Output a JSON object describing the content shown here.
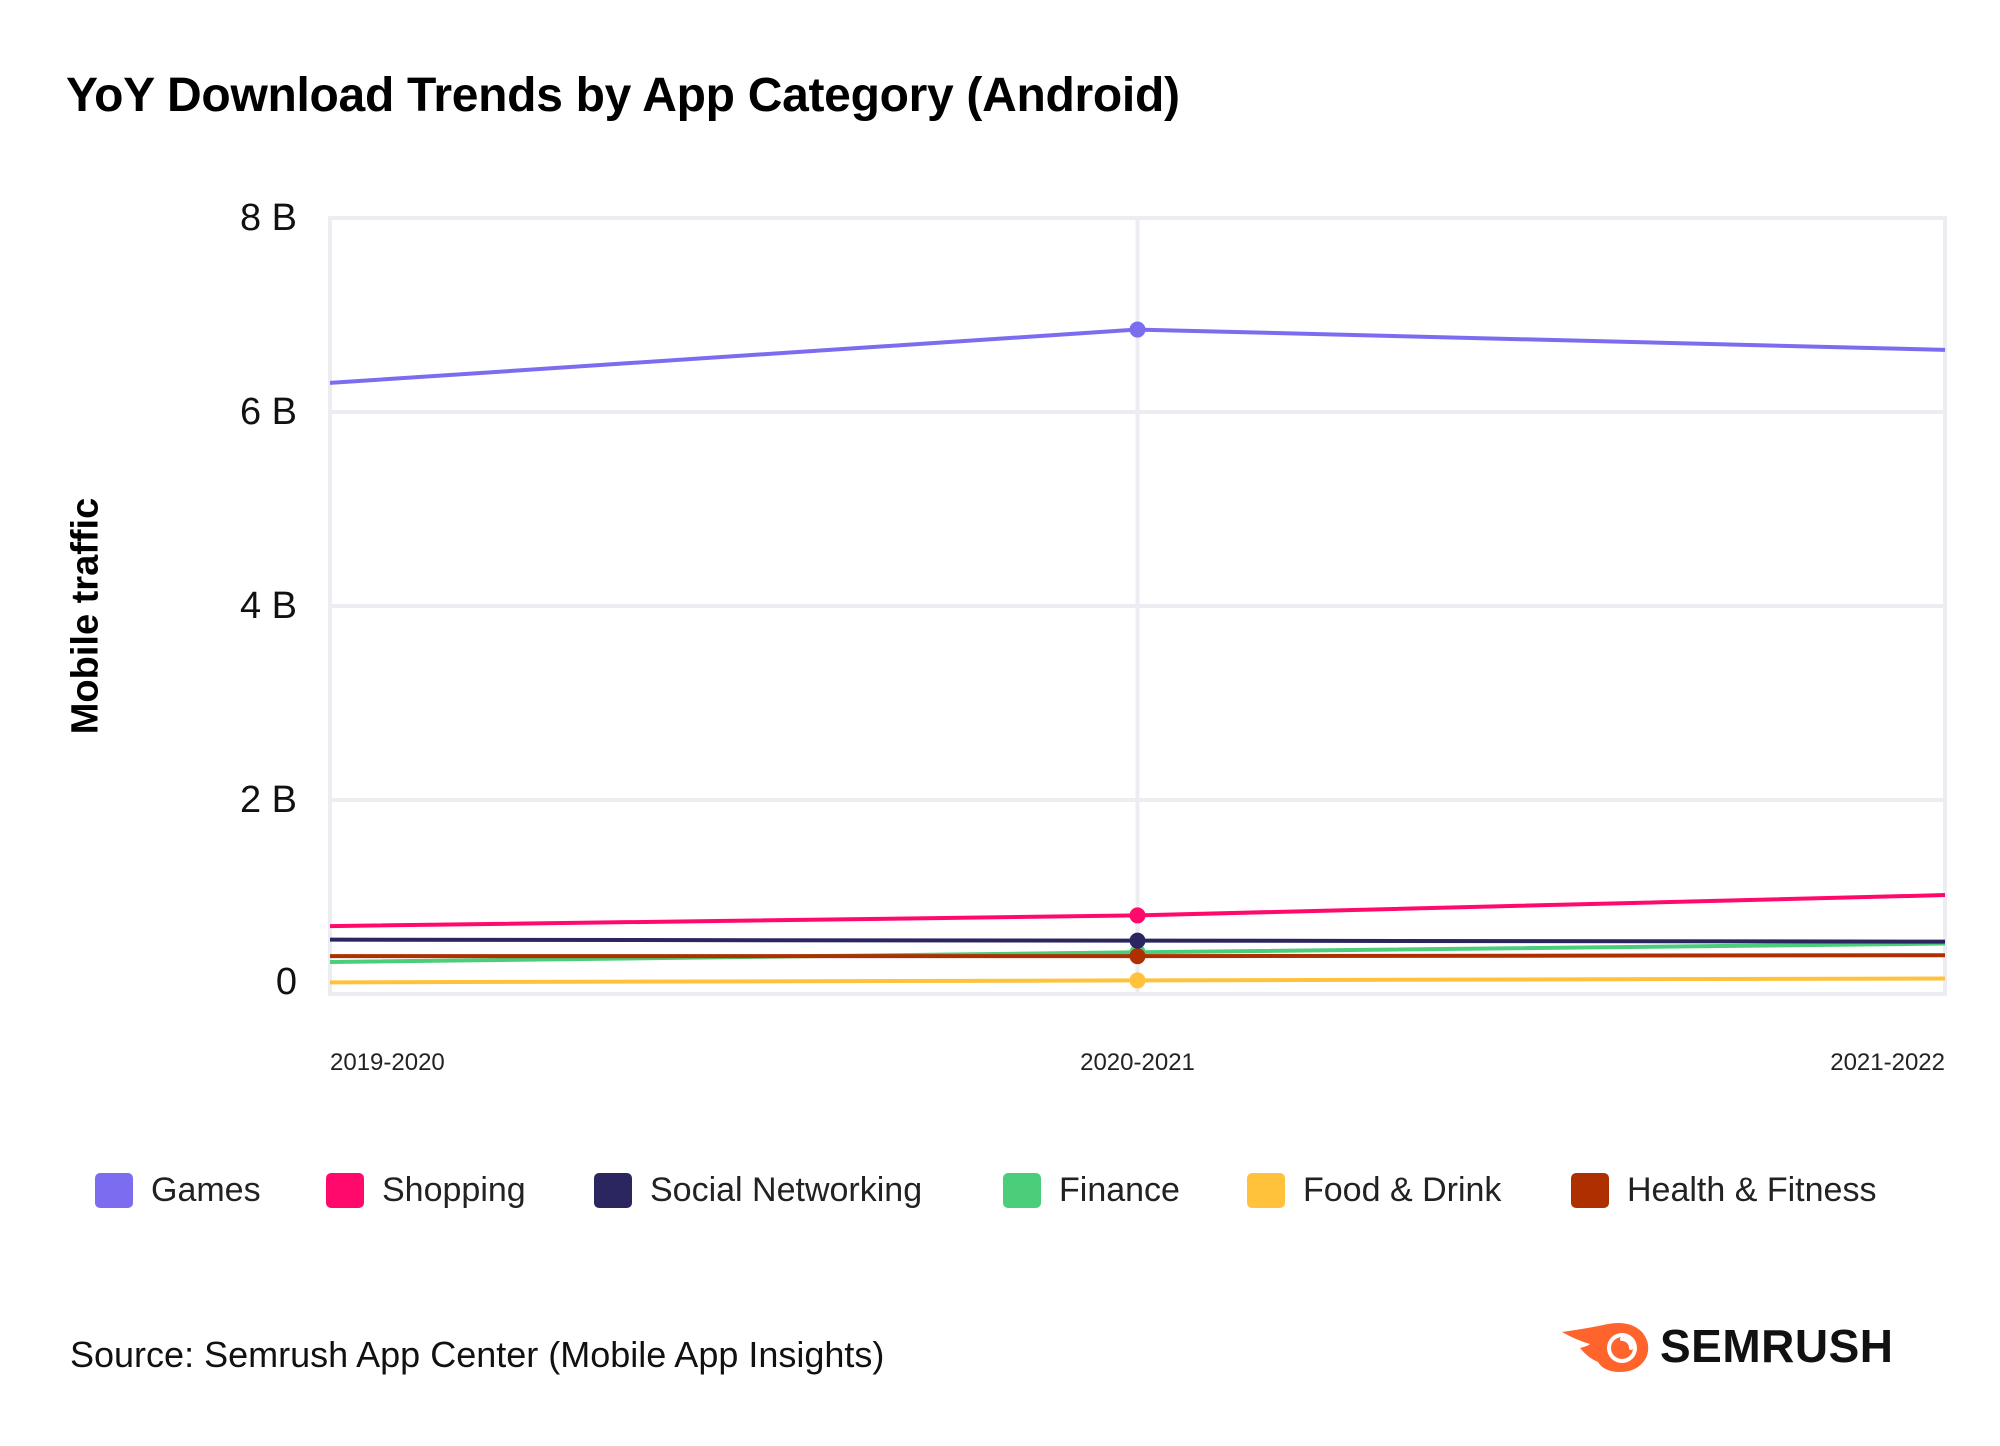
{
  "title": "YoY Download Trends by App Category (Android)",
  "source": "Source: Semrush App Center (Mobile App Insights)",
  "brand": {
    "name": "SEMRUSH",
    "icon": "semrush-fireball-icon",
    "color": "#FF642D"
  },
  "chart_data": {
    "type": "line",
    "title": "YoY Download Trends by App Category (Android)",
    "xlabel": "",
    "ylabel": "Mobile traffic",
    "x": [
      "2019-2020",
      "2020-2021",
      "2021-2022"
    ],
    "ylim": [
      0,
      8
    ],
    "yunit": "B",
    "yticks": [
      0,
      2,
      4,
      6,
      8
    ],
    "ytick_labels": [
      "0",
      "2 B",
      "4 B",
      "6 B",
      "8 B"
    ],
    "grid": true,
    "legend_position": "bottom",
    "marker_on_index": 1,
    "series": [
      {
        "name": "Games",
        "color": "#7B6CF0",
        "values": [
          6.3,
          6.85,
          6.64
        ]
      },
      {
        "name": "Shopping",
        "color": "#FF0A6C",
        "values": [
          0.7,
          0.81,
          1.02
        ]
      },
      {
        "name": "Social Networking",
        "color": "#2B2560",
        "values": [
          0.56,
          0.55,
          0.54
        ]
      },
      {
        "name": "Finance",
        "color": "#4ACE7A",
        "values": [
          0.33,
          0.43,
          0.52
        ]
      },
      {
        "name": "Food & Drink",
        "color": "#FFC23A",
        "values": [
          0.12,
          0.14,
          0.16
        ]
      },
      {
        "name": "Health & Fitness",
        "color": "#AE2F00",
        "values": [
          0.39,
          0.39,
          0.4
        ]
      }
    ]
  }
}
